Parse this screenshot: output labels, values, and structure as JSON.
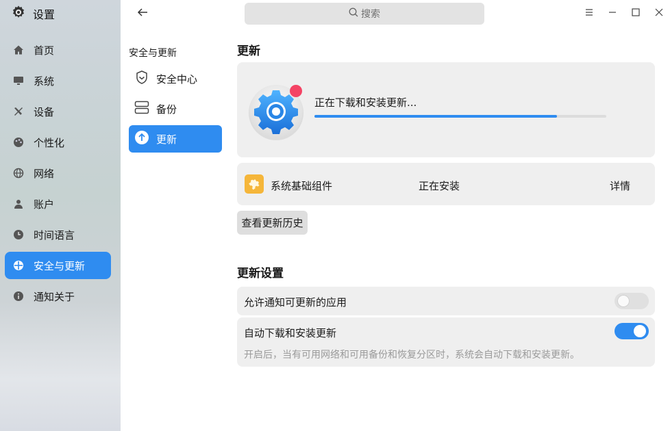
{
  "app": {
    "title": "设置",
    "icon": "gear-icon"
  },
  "nav": {
    "items": [
      {
        "label": "首页",
        "icon": "home-icon"
      },
      {
        "label": "系统",
        "icon": "monitor-icon"
      },
      {
        "label": "设备",
        "icon": "tools-icon"
      },
      {
        "label": "个性化",
        "icon": "palette-icon"
      },
      {
        "label": "网络",
        "icon": "globe-icon"
      },
      {
        "label": "账户",
        "icon": "user-icon"
      },
      {
        "label": "时间语言",
        "icon": "clock-icon"
      },
      {
        "label": "安全与更新",
        "icon": "security-update-icon",
        "active": true
      },
      {
        "label": "通知关于",
        "icon": "info-icon"
      }
    ]
  },
  "sub": {
    "title": "安全与更新",
    "items": [
      {
        "label": "安全中心",
        "icon": "shield-icon"
      },
      {
        "label": "备份",
        "icon": "backup-icon"
      },
      {
        "label": "更新",
        "icon": "upload-circle-icon",
        "active": true
      }
    ]
  },
  "search": {
    "placeholder": "搜索"
  },
  "update": {
    "heading": "更新",
    "status": "正在下载和安装更新...",
    "progress": 0.83,
    "component": {
      "name": "系统基础组件",
      "status": "正在安装",
      "detail": "详情"
    },
    "history_button": "查看更新历史"
  },
  "settings": {
    "heading": "更新设置",
    "notify": {
      "label": "允许通知可更新的应用",
      "enabled": false
    },
    "auto": {
      "label": "自动下载和安装更新",
      "enabled": true,
      "description": "开启后，当有可用网络和可用备份和恢复分区时，系统会自动下载和安装更新。"
    }
  },
  "colors": {
    "accent": "#2f8cf0",
    "badge": "#f44364"
  }
}
